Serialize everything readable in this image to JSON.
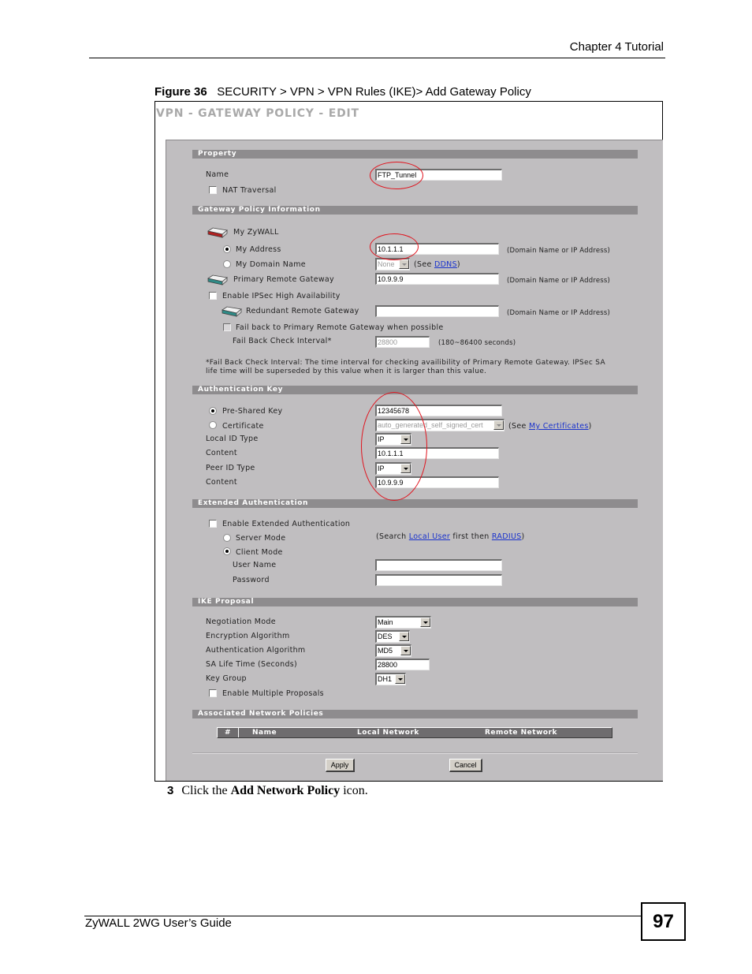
{
  "page_header": {
    "chapter": "Chapter 4 Tutorial"
  },
  "figure": {
    "label": "Figure 36",
    "caption": "SECURITY > VPN > VPN Rules (IKE)> Add Gateway Policy"
  },
  "ui": {
    "title": "VPN - GATEWAY POLICY - EDIT",
    "property": {
      "section_label": "Property",
      "name_label": "Name",
      "name_value": "FTP_Tunnel",
      "nat_traversal_label": "NAT Traversal",
      "nat_traversal_checked": false
    },
    "gateway_policy": {
      "section_label": "Gateway Policy Information",
      "my_zywall_label": "My ZyWALL",
      "my_address_label": "My Address",
      "my_address_value": "10.1.1.1",
      "my_address_selected": true,
      "my_domain_name_label": "My Domain Name",
      "my_domain_name_value": "None",
      "see_prefix": "(See ",
      "ddns_link": "DDNS",
      "see_suffix": ")",
      "domain_hint": "(Domain Name or IP Address)",
      "primary_remote_gateway_label": "Primary Remote Gateway",
      "primary_remote_gateway_value": "10.9.9.9",
      "enable_ha_label": "Enable IPSec High Availability",
      "enable_ha_checked": false,
      "redundant_remote_gateway_label": "Redundant Remote Gateway",
      "redundant_remote_gateway_value": "",
      "fail_back_label": "Fail back to Primary Remote Gateway when possible",
      "fail_back_checked": false,
      "fail_back_interval_label": "Fail Back Check Interval*",
      "fail_back_interval_value": "28800",
      "fail_back_interval_hint": "(180~86400 seconds)",
      "footnote_line1": "*Fail Back Check Interval: The time interval for checking availibility of Primary Remote Gateway. IPSec SA",
      "footnote_line2": "life time will be superseded by this value when it is larger than this value."
    },
    "authentication_key": {
      "section_label": "Authentication Key",
      "pre_shared_key_label": "Pre-Shared Key",
      "pre_shared_key_value": "12345678",
      "pre_shared_key_selected": true,
      "certificate_label": "Certificate",
      "certificate_value": "auto_generated_self_signed_cert",
      "see_prefix": "(See ",
      "my_certificates_link": "My Certificates",
      "see_suffix": ")",
      "local_id_type_label": "Local ID Type",
      "local_id_type_value": "IP",
      "local_content_label": "Content",
      "local_content_value": "10.1.1.1",
      "peer_id_type_label": "Peer ID Type",
      "peer_id_type_value": "IP",
      "peer_content_label": "Content",
      "peer_content_value": "10.9.9.9"
    },
    "extended_authentication": {
      "section_label": "Extended Authentication",
      "enable_label": "Enable Extended Authentication",
      "enable_checked": false,
      "server_mode_label": "Server Mode",
      "client_mode_label": "Client Mode",
      "client_mode_selected": true,
      "search_prefix": "(Search ",
      "local_user_link": "Local User",
      "search_middle": " first then ",
      "radius_link": "RADIUS",
      "search_suffix": ")",
      "user_name_label": "User Name",
      "user_name_value": "",
      "password_label": "Password",
      "password_value": ""
    },
    "ike_proposal": {
      "section_label": "IKE Proposal",
      "negotiation_mode_label": "Negotiation Mode",
      "negotiation_mode_value": "Main",
      "encryption_algorithm_label": "Encryption Algorithm",
      "encryption_algorithm_value": "DES",
      "authentication_algorithm_label": "Authentication Algorithm",
      "authentication_algorithm_value": "MD5",
      "sa_life_time_label": "SA Life Time (Seconds)",
      "sa_life_time_value": "28800",
      "key_group_label": "Key Group",
      "key_group_value": "DH1",
      "enable_multiple_proposals_label": "Enable Multiple Proposals",
      "enable_multiple_proposals_checked": false
    },
    "associated_network_policies": {
      "section_label": "Associated Network Policies",
      "columns": [
        "#",
        "Name",
        "Local Network",
        "Remote Network"
      ]
    },
    "buttons": {
      "apply": "Apply",
      "cancel": "Cancel"
    },
    "colors": {
      "highlight_ring": "#e0141e",
      "section_bar": "#8e8c8e",
      "panel_bg": "#c0bec0",
      "link": "#1a33cc"
    }
  },
  "step": {
    "number": "3",
    "text_prefix": "Click the ",
    "text_bold": "Add Network Policy",
    "text_suffix": " icon."
  },
  "page_footer": {
    "guide_title": "ZyWALL 2WG User’s Guide",
    "page_number": "97"
  }
}
